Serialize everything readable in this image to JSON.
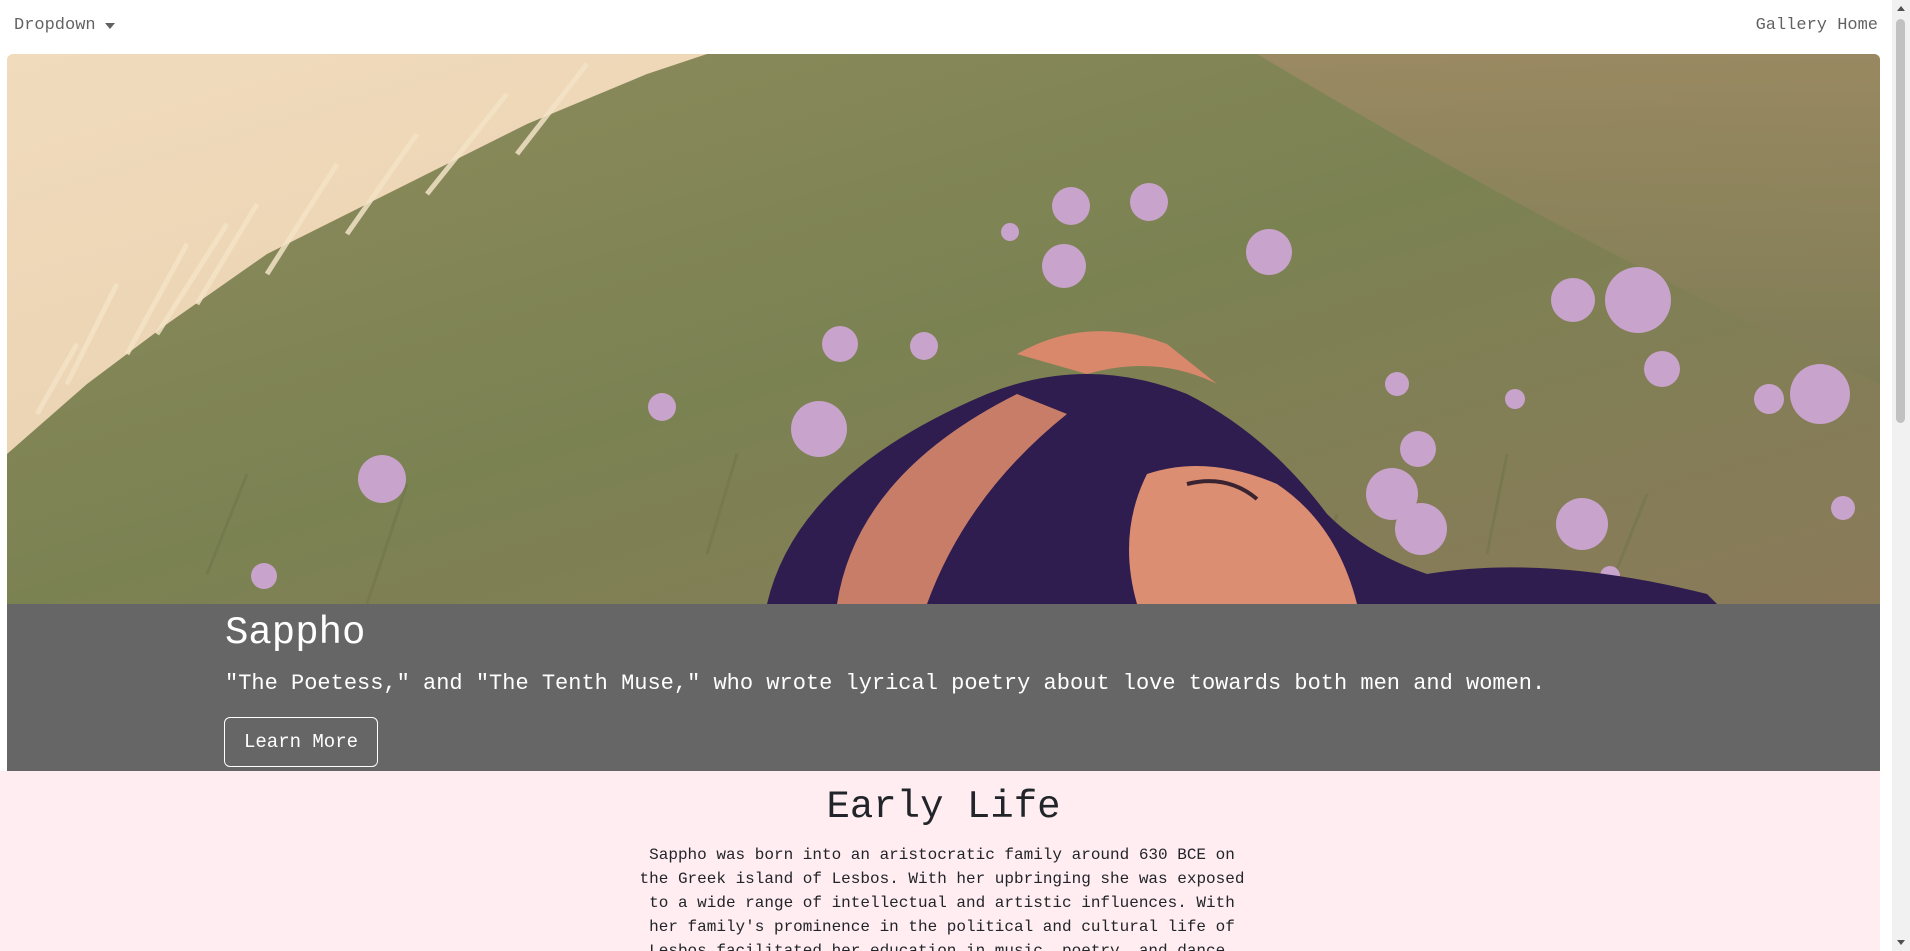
{
  "navbar": {
    "dropdown_label": "Dropdown",
    "home_link": "Gallery Home"
  },
  "hero": {
    "image_description": "illustration of a woman with dark hair lying in green grass with pink flowers",
    "title": "Sappho",
    "subtitle": "\"The Poetess,\" and \"The Tenth Muse,\" who wrote lyrical poetry about love towards both men and women.",
    "button_label": "Learn More"
  },
  "early_life": {
    "heading": "Early Life",
    "body": "Sappho was born into an aristocratic family around 630 BCE on the Greek island of Lesbos. With her upbringing she was exposed to a wide range of intellectual and artistic influences. With her family's prominence in the political and cultural life of Lesbos facilitated her education in music, poetry, and dance."
  },
  "colors": {
    "caption_band": "#666666",
    "section_bg": "#ffedf2",
    "grass": "#7f8458",
    "sky": "#ead4b3",
    "flower": "#c8a3cc",
    "hair": "#2e1d4e",
    "skin": "#d9886c"
  },
  "icons": {
    "dropdown_caret": "caret-down-icon"
  }
}
